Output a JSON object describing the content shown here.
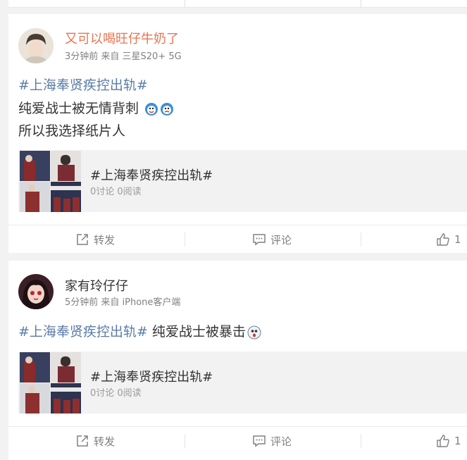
{
  "posts": [
    {
      "author": "又可以喝旺仔牛奶了",
      "meta": "3分钟前 来自 三星S20+ 5G",
      "topic": "#上海奉贤疾控出轨#",
      "text_line": "纯爱战士被无情背刺",
      "text_line2": "所以我选择纸片人",
      "embed": {
        "title": "#上海奉贤疾控出轨#",
        "stats": "0讨论 0阅读"
      },
      "actions": {
        "repost": "转发",
        "comment": "评论",
        "like_count": "1"
      }
    },
    {
      "author": "家有玲仔仔",
      "meta": "5分钟前 来自 iPhone客户端",
      "topic": "#上海奉贤疾控出轨#",
      "text_line": "纯爱战士被暴击",
      "embed": {
        "title": "#上海奉贤疾控出轨#",
        "stats": "0讨论 0阅读"
      },
      "actions": {
        "repost": "转发",
        "comment": "评论",
        "like_count": "1"
      }
    }
  ],
  "colors": {
    "author_highlight": "#eb7350",
    "topic_link": "#5b7ca8",
    "muted": "#808080"
  },
  "icons": [
    "repost-icon",
    "comment-icon",
    "like-icon",
    "emoji-icon"
  ]
}
